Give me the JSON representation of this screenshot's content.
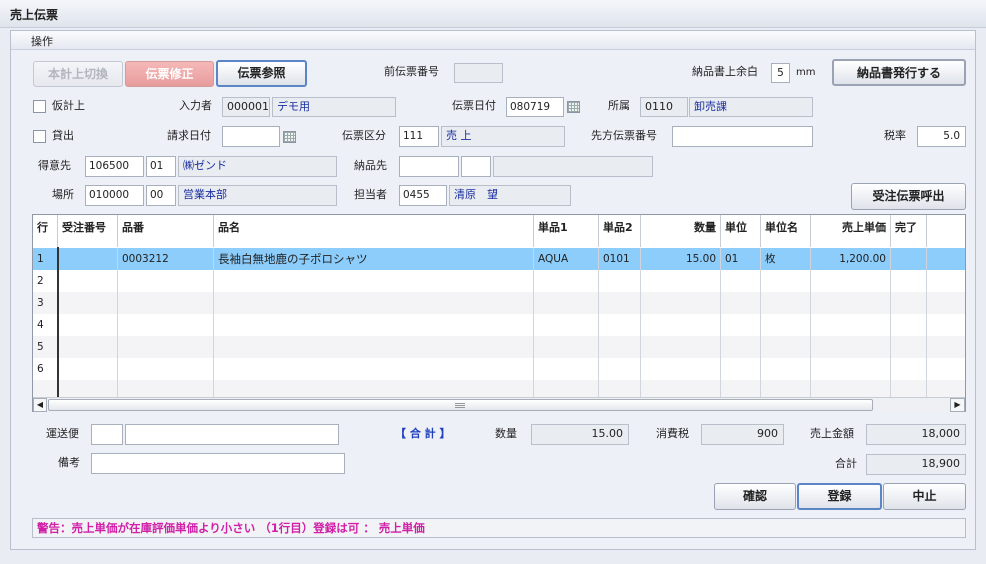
{
  "window": {
    "title": "売上伝票"
  },
  "menu": {
    "operation": "操作"
  },
  "toolbar": {
    "btn_main_switch": "本計上切換",
    "btn_fix": "伝票修正",
    "btn_ref": "伝票参照",
    "prev_slip_label": "前伝票番号",
    "prev_slip_value": "",
    "margin_label": "納品書上余白",
    "margin_value": "5",
    "margin_unit": "mm",
    "btn_issue": "納品書発行する"
  },
  "form": {
    "provisional_label": "仮計上",
    "loan_label": "貸出",
    "entry_label": "入力者",
    "entry_code": "000001",
    "entry_name": "デモ用",
    "slip_date_label": "伝票日付",
    "slip_date_value": "080719",
    "dept_label": "所属",
    "dept_code": "0110",
    "dept_name": "卸売課",
    "bill_date_label": "請求日付",
    "bill_date_value": "",
    "slip_type_label": "伝票区分",
    "slip_type_code": "111",
    "slip_type_name": "売 上",
    "partner_slip_label": "先方伝票番号",
    "partner_slip_value": "",
    "tax_label": "税率",
    "tax_value": "5.0",
    "customer_label": "得意先",
    "customer_code": "106500",
    "customer_sub": "01",
    "customer_name": "㈱ゼンド",
    "delivery_label": "納品先",
    "delivery_code": "",
    "delivery_sub": "",
    "delivery_name": "",
    "place_label": "場所",
    "place_code": "010000",
    "place_sub": "00",
    "place_name": "営業本部",
    "staff_label": "担当者",
    "staff_code": "0455",
    "staff_name": "清原　望",
    "btn_order_call": "受注伝票呼出"
  },
  "grid": {
    "headers": [
      "行",
      "受注番号",
      "品番",
      "品名",
      "単品1",
      "単品2",
      "数量",
      "単位",
      "単位名",
      "売上単価",
      "完了"
    ],
    "rows": [
      {
        "no": "1",
        "order_no": "",
        "item_code": "0003212",
        "item_name": "長袖白無地鹿の子ポロシャツ",
        "sku1": "AQUA",
        "sku2": "0101",
        "qty": "15.00",
        "unit": "01",
        "unit_name": "枚",
        "price": "1,200.00",
        "done": ""
      },
      {
        "no": "2"
      },
      {
        "no": "3"
      },
      {
        "no": "4"
      },
      {
        "no": "5"
      },
      {
        "no": "6"
      }
    ]
  },
  "footer": {
    "carrier_label": "運送便",
    "carrier_code": "",
    "carrier_name": "",
    "memo_label": "備考",
    "memo_value": "",
    "total_title": "【 合 計 】",
    "qty_label": "数量",
    "qty_value": "15.00",
    "tax_label": "消費税",
    "tax_value": "900",
    "sales_label": "売上金額",
    "sales_value": "18,000",
    "sum_label": "合計",
    "sum_value": "18,900",
    "btn_confirm": "確認",
    "btn_register": "登録",
    "btn_cancel": "中止"
  },
  "status": {
    "message": "警告：売上単価が在庫評価単価より小さい （1行目）登録は可 ： 売上単価"
  }
}
